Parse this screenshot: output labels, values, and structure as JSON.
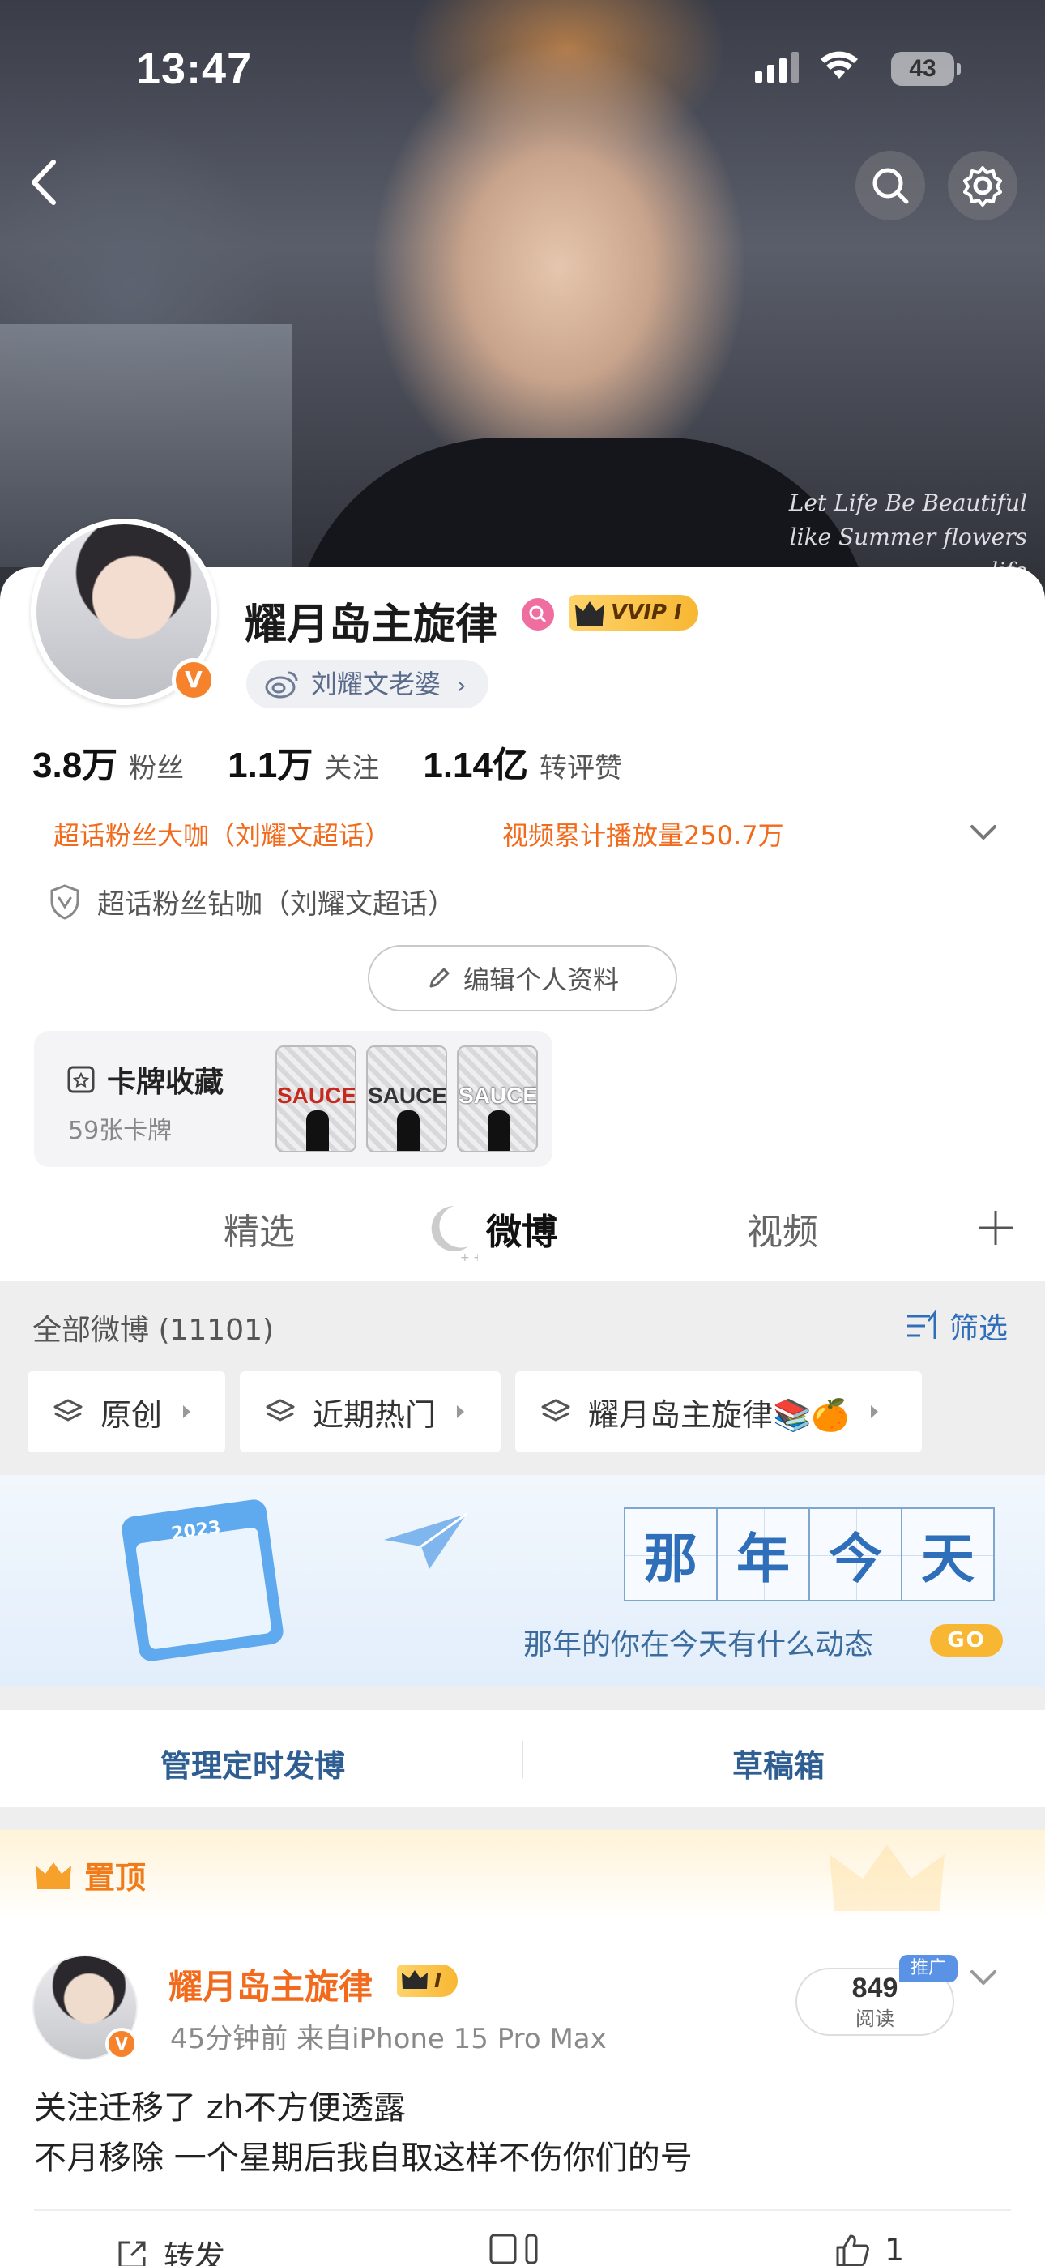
{
  "status_bar": {
    "time": "13:47",
    "battery": "43"
  },
  "hero": {
    "caption_lines": [
      "Let Life Be Beautiful",
      "like Summer flowers",
      "life"
    ]
  },
  "profile": {
    "name": "耀月岛主旋律",
    "vip_label": "VVIP Ⅰ",
    "super_topic_tag": "刘耀文老婆",
    "verified_mark": "V",
    "stats": [
      {
        "value": "3.8万",
        "label": "粉丝"
      },
      {
        "value": "1.1万",
        "label": "关注"
      },
      {
        "value": "1.14亿",
        "label": "转评赞"
      }
    ],
    "honor_1": "超话粉丝大咖（刘耀文超话）",
    "honor_2": "视频累计播放量250.7万",
    "honor_3": "超话粉丝钻咖（刘耀文超话）",
    "edit_label": "编辑个人资料",
    "cards": {
      "title": "卡牌收藏",
      "count": "59张卡牌",
      "card_text": "SAUCE"
    }
  },
  "tabs": [
    {
      "label": "精选"
    },
    {
      "label": "微博"
    },
    {
      "label": "视频"
    }
  ],
  "filters": {
    "all_label": "全部微博 (11101)",
    "filter_link": "筛选",
    "chips": [
      "原创",
      "近期热门",
      "耀月岛主旋律📚🍊"
    ]
  },
  "memories_banner": {
    "year": "2023",
    "chars": [
      "那",
      "年",
      "今",
      "天"
    ],
    "subtitle": "那年的你在今天有什么动态",
    "go": "GO"
  },
  "actions": {
    "scheduled": "管理定时发博",
    "drafts": "草稿箱"
  },
  "pinned": {
    "label": "置顶",
    "author": "耀月岛主旋律",
    "vip_label": "Ⅰ",
    "meta": "45分钟前  来自iPhone 15 Pro Max",
    "reads": "849",
    "reads_label": "阅读",
    "promo": "推广",
    "text_lines": [
      "关注迁移了 zh不方便透露",
      "不月移除 一个星期后我自取这样不伤你们的号"
    ],
    "repost_label": "转发",
    "like_count": "1"
  },
  "colors": {
    "accent_orange": "#f26a1b",
    "link_blue": "#2f6eb9",
    "vip_gold": "#f7b733"
  }
}
